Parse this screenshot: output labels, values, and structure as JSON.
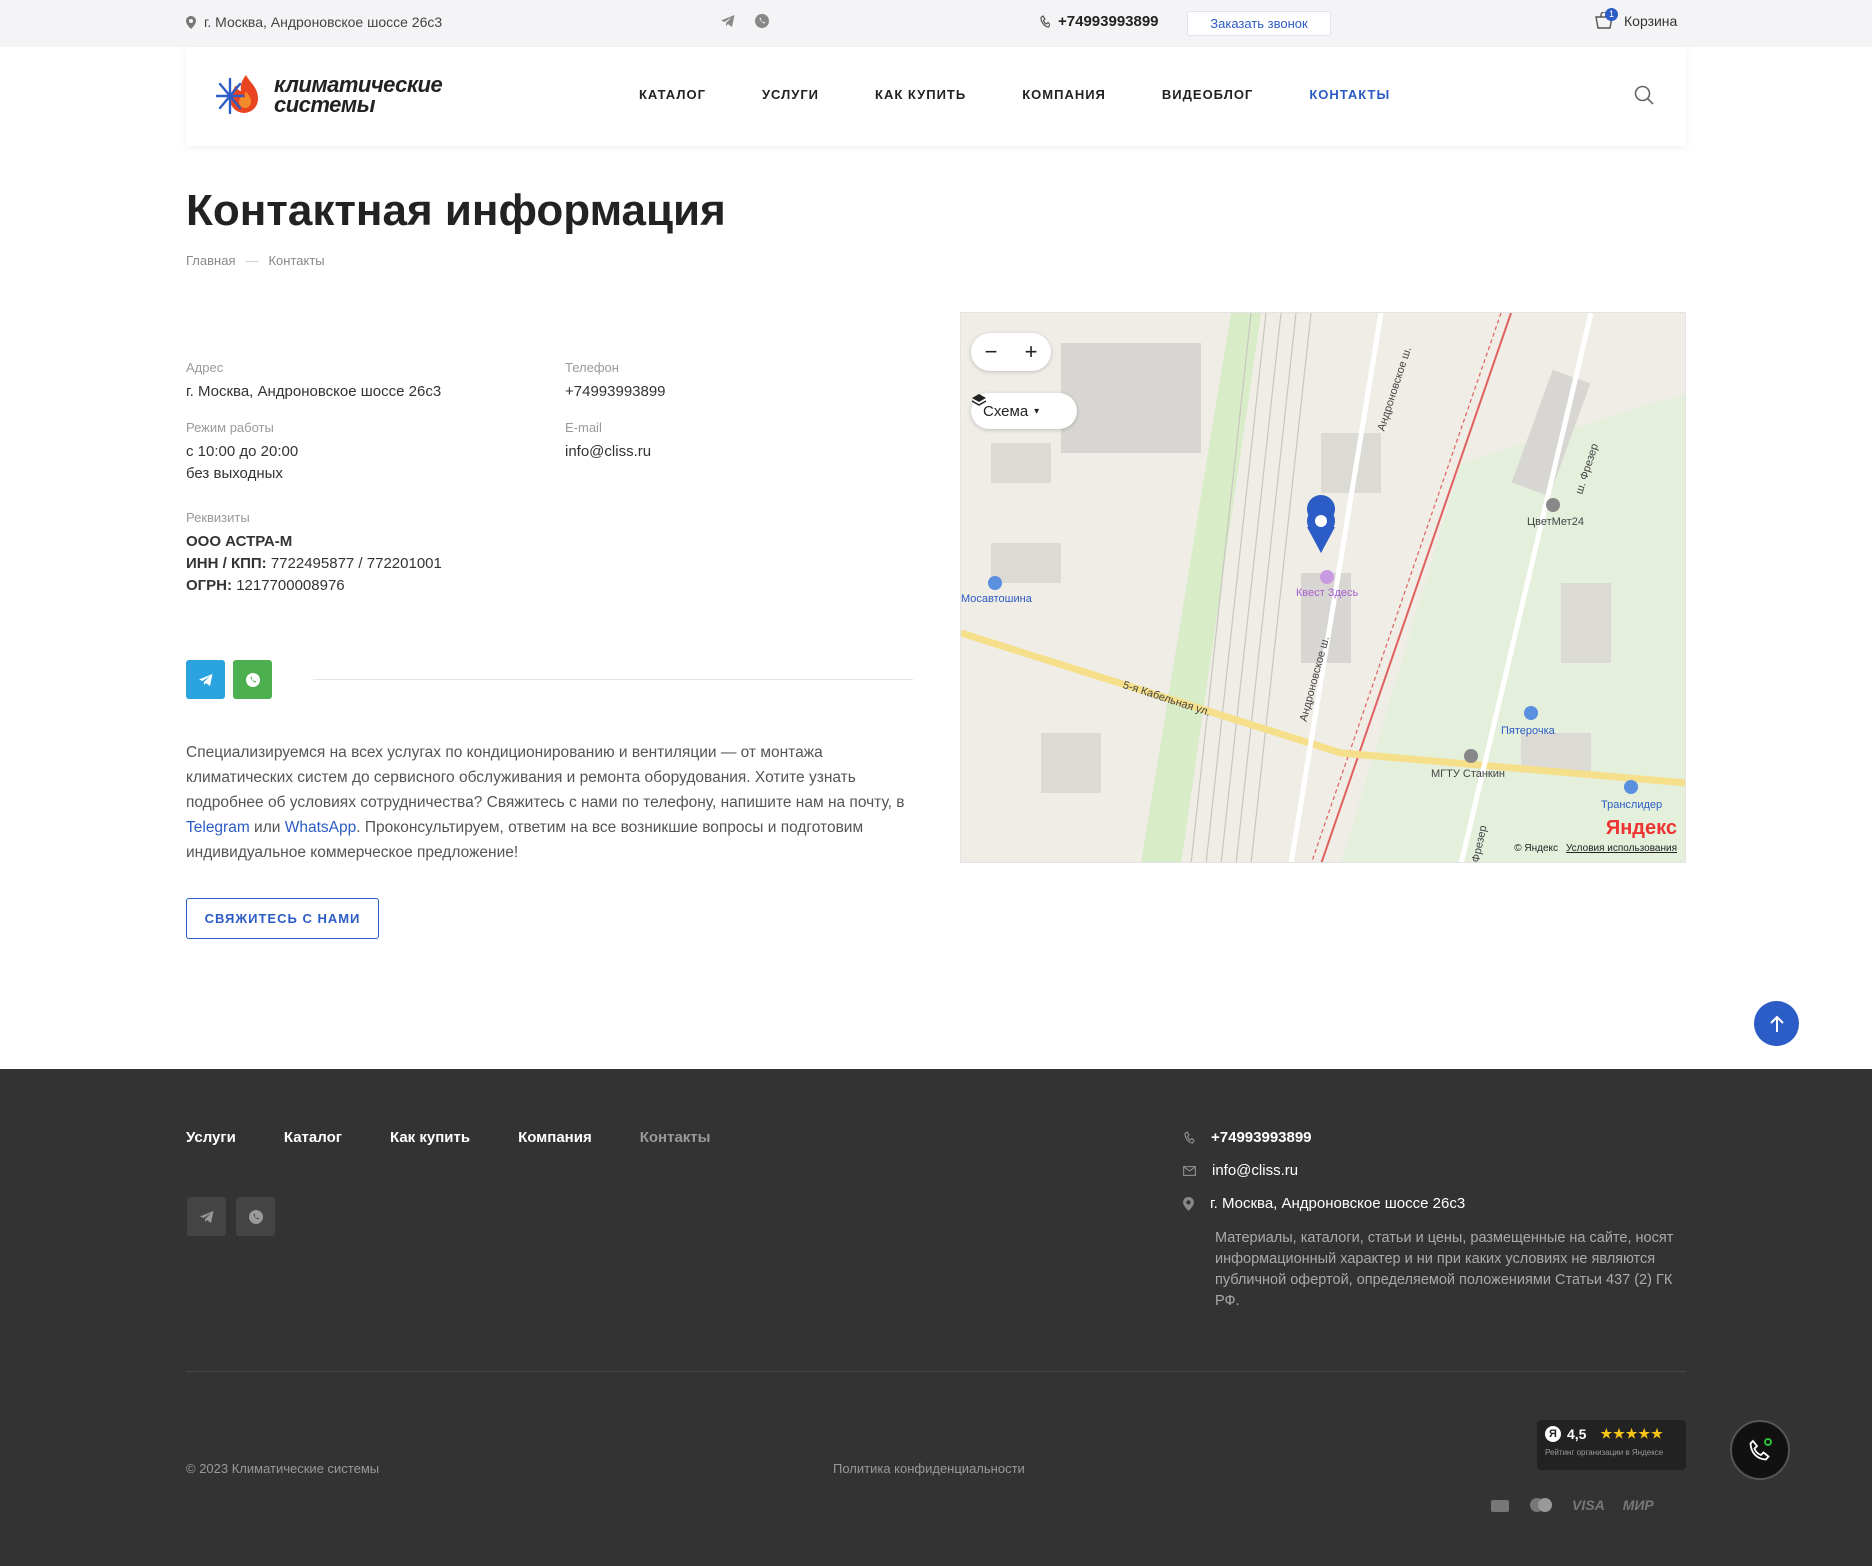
{
  "topbar": {
    "address": "г. Москва, Андроновское шоссе 26с3",
    "phone": "+74993993899",
    "callback_label": "Заказать звонок",
    "cart_label": "Корзина",
    "cart_count": "1"
  },
  "header": {
    "logo_line1": "климатические",
    "logo_line2": "системы",
    "nav": [
      "КАТАЛОГ",
      "УСЛУГИ",
      "КАК КУПИТЬ",
      "КОМПАНИЯ",
      "ВИДЕОБЛОГ",
      "КОНТАКТЫ"
    ],
    "active_nav": "КОНТАКТЫ"
  },
  "page": {
    "title": "Контактная информация",
    "breadcrumb": [
      "Главная",
      "Контакты"
    ]
  },
  "contacts": {
    "address_label": "Адрес",
    "address_value": "г. Москва, Андроновское шоссе 26с3",
    "phone_label": "Телефон",
    "phone_value": "+74993993899",
    "hours_label": "Режим работы",
    "hours_line1": "с 10:00 до 20:00",
    "hours_line2": "без выходных",
    "email_label": "E-mail",
    "email_value": "info@cliss.ru",
    "requisites_label": "Реквизиты",
    "company": "ООО АСТРА-М",
    "inn_label": "ИНН / КПП:",
    "inn_value": "7722495877 / 772201001",
    "ogrn_label": "ОГРН:",
    "ogrn_value": "1217700008976"
  },
  "description": {
    "part1": "Специализируемся на всех услугах по кондиционированию и вентиляции — от монтажа климатических систем до сервисного обслуживания и ремонта оборудования. Хотите узнать подробнее об условиях сотрудничества? Свяжитесь с нами по телефону, напишите нам на почту, в ",
    "telegram": "Telegram",
    "or": " или ",
    "whatsapp": "WhatsApp",
    "part2": ". Проконсультируем, ответим на все возникшие вопросы и подготовим индивидуальное коммерческое предложение!"
  },
  "contact_button": "СВЯЖИТЕСЬ С НАМИ",
  "map": {
    "layer_label": "Схема",
    "zoom_out": "−",
    "zoom_in": "+",
    "brand": "Яндекс",
    "copyright": "© Яндекс",
    "terms": "Условия использования",
    "labels": {
      "quest": "Квест Здесь",
      "mosavtoshina": "Мосавтошина",
      "pyaterochka": "Пятерочка",
      "stankin": "МГТУ Станкин",
      "translider": "Транслидер",
      "tsvetmet": "ЦветМет24",
      "street1": "5-я Кабельная ул.",
      "street2": "Андроновское ш.",
      "street3": "Андроновское ш.",
      "street4": "ш. Фрезер",
      "street5": "Фрезер"
    }
  },
  "footer": {
    "nav": [
      "Услуги",
      "Каталог",
      "Как купить",
      "Компания",
      "Контакты"
    ],
    "active_nav": "Контакты",
    "phone": "+74993993899",
    "email": "info@cliss.ru",
    "address": "г. Москва, Андроновское шоссе 26с3",
    "disclaimer": "Материалы, каталоги, статьи и цены, размещенные на сайте, носят информационный характер и ни при каких условиях не являются публичной офертой, определяемой положениями Статьи 437 (2) ГК РФ.",
    "copyright": "© 2023 Климатические системы",
    "policy": "Политика конфиденциальности",
    "rating_value": "4,5",
    "rating_caption": "Рейтинг организации в Яндексе",
    "payment": [
      "VISA",
      "МИР"
    ]
  },
  "colors": {
    "accent": "#2c5cc5",
    "telegram": "#2aa3df",
    "whatsapp": "#4caf50",
    "footer_bg": "#333333"
  }
}
